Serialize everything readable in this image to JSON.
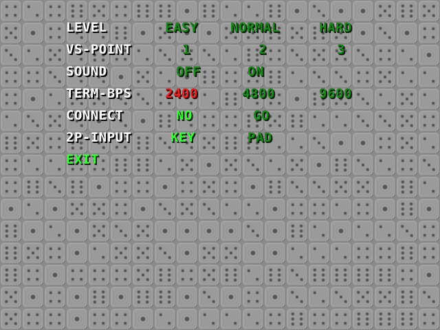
{
  "colors": {
    "background": "#8a8a8a",
    "label": "#ffffff",
    "option": "#1a8a1a",
    "option_selected": "#33ff33",
    "option_alert": "#ee2222"
  },
  "background_pattern": "dice-tiles",
  "menu": {
    "level": {
      "label": "LEVEL",
      "options": [
        "EASY",
        "NORMAL",
        "HARD"
      ]
    },
    "vs_point": {
      "label": "VS-POINT",
      "options": [
        "1",
        "2",
        "3"
      ]
    },
    "sound": {
      "label": "SOUND",
      "options": [
        "OFF",
        "ON"
      ]
    },
    "term_bps": {
      "label": "TERM-BPS",
      "options": [
        "2400",
        "4800",
        "9600"
      ],
      "selected": "2400"
    },
    "connect": {
      "label": "CONNECT",
      "options": [
        "NO",
        "GO"
      ],
      "selected": "NO"
    },
    "input_2p": {
      "label": "2P-INPUT",
      "options": [
        "KEY",
        "PAD"
      ],
      "selected": "KEY"
    },
    "exit": {
      "label": "EXIT"
    }
  }
}
